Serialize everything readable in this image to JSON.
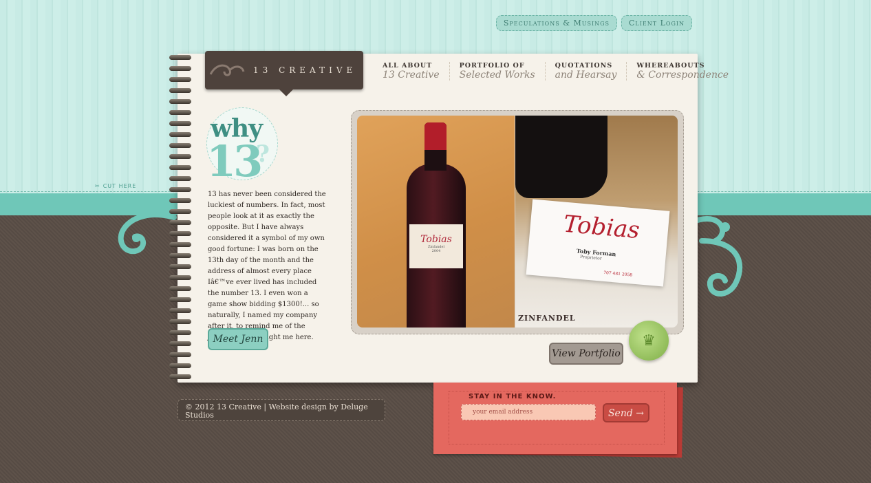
{
  "top_nav": {
    "speculations": "Speculations & Musings",
    "client_login": "Client Login"
  },
  "cut_here": "cut here",
  "logo": {
    "text": "13 CREATIVE"
  },
  "main_nav": [
    {
      "top": "ALL ABOUT",
      "bottom": "13 Creative"
    },
    {
      "top": "PORTFOLIO OF",
      "bottom": "Selected Works"
    },
    {
      "top": "QUOTATIONS",
      "bottom": "and Hearsay"
    },
    {
      "top": "WHEREABOUTS",
      "bottom": "& Correspondence"
    }
  ],
  "why13": {
    "why": "why",
    "number": "13",
    "qmark": "?"
  },
  "intro": "13 has never been considered the luckiest of numbers. In fact, most people look at it as exactly the opposite. But I have always considered it a symbol of my own good fortune: I was born on the 13th day of the month and the address of almost every place Iâ€™ve ever lived has included the number 13. I even won a game show bidding $1300!... so naturally, I named my company after it, to remind me of the journey that brought me here.",
  "meet_button": "Meet Jenn",
  "view_portfolio_button": "View Portfolio",
  "photo": {
    "label_brand": "Tobias",
    "label_sub": "Zinfandel",
    "label_year": "2004",
    "card_brand": "Tobias",
    "card_name": "Toby Forman",
    "card_title": "Proprietor",
    "card_phone": "707 481 2058",
    "zinfandel": "ZINFANDEL"
  },
  "footer": "© 2012 13 Creative | Website design by Deluge Studios",
  "newsletter": {
    "label": "Stay in the know.",
    "placeholder": "your email address",
    "send": "Send →"
  },
  "colors": {
    "teal": "#6fc7b8",
    "brown": "#4e423c",
    "red": "#e4685f",
    "paper": "#f6f2ea"
  }
}
